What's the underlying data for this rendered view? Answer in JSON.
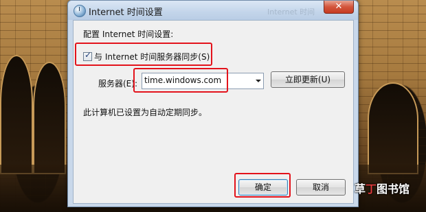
{
  "window": {
    "title": "Internet 时间设置",
    "ghost_title": "Internet 时间",
    "close_glyph": "✕"
  },
  "panel": {
    "section_label": "配置 Internet 时间设置:",
    "sync_checkbox_label": "与 Internet 时间服务器同步(S)",
    "sync_checked": true,
    "server_label": "服务器(E):",
    "server_value": "time.windows.com",
    "update_button": "立即更新(U)",
    "status_text": "此计算机已设置为自动定期同步。"
  },
  "footer": {
    "ok_button": "确定",
    "cancel_button": "取消"
  },
  "watermark": {
    "part1": "草",
    "part2": "丁",
    "part3": "图书馆"
  },
  "colors": {
    "highlight": "#e3121b",
    "window_frame": "#c9d8ea",
    "close_button": "#c63a22"
  }
}
